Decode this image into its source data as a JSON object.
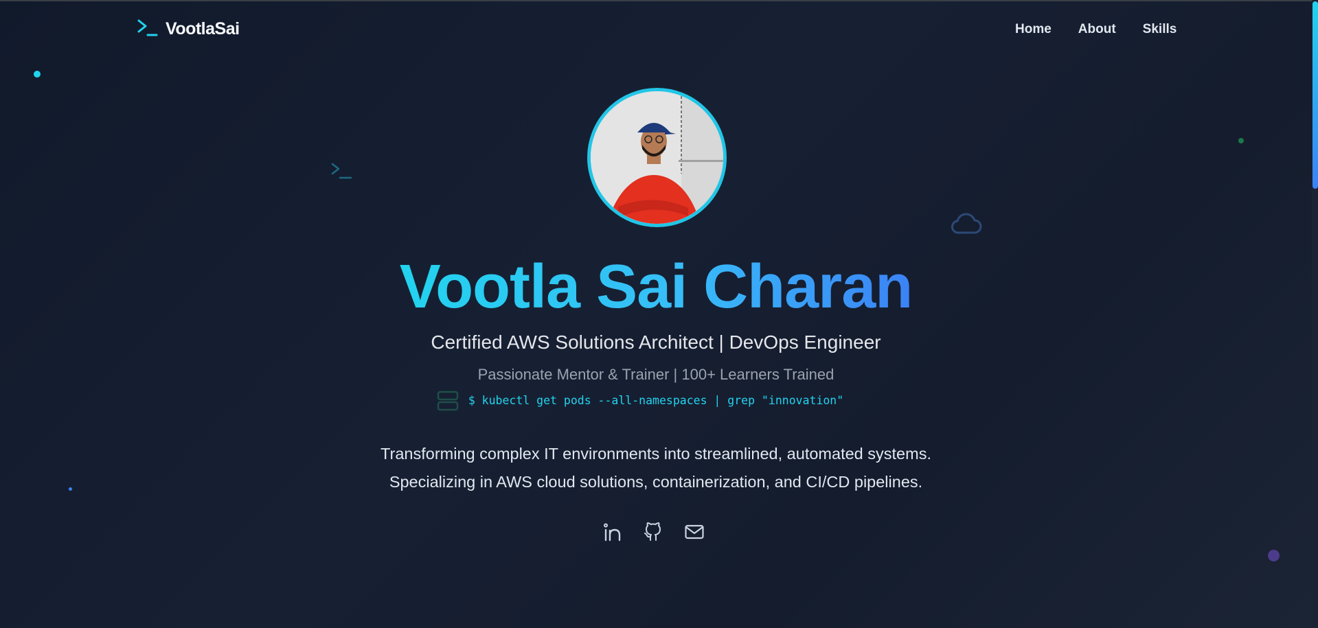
{
  "nav": {
    "brand_icon": "terminal-icon",
    "brand": "VootlaSai",
    "links": [
      {
        "label": "Home"
      },
      {
        "label": "About"
      },
      {
        "label": "Skills"
      }
    ]
  },
  "hero": {
    "avatar_alt": "Profile photo",
    "name": "Vootla Sai Charan",
    "title": "Certified AWS Solutions Architect | DevOps Engineer",
    "subtitle": "Passionate Mentor & Trainer | 100+ Learners Trained",
    "command": "$ kubectl get pods --all-namespaces | grep \"innovation\"",
    "description_line1": "Transforming complex IT environments into streamlined, automated systems.",
    "description_line2": "Specializing in AWS cloud solutions, containerization, and CI/CD pipelines."
  },
  "socials": [
    {
      "icon": "linkedin-icon"
    },
    {
      "icon": "github-icon"
    },
    {
      "icon": "mail-icon"
    }
  ],
  "colors": {
    "accent_cyan": "#22d3ee",
    "accent_blue": "#3b82f6",
    "background": "#172033"
  }
}
